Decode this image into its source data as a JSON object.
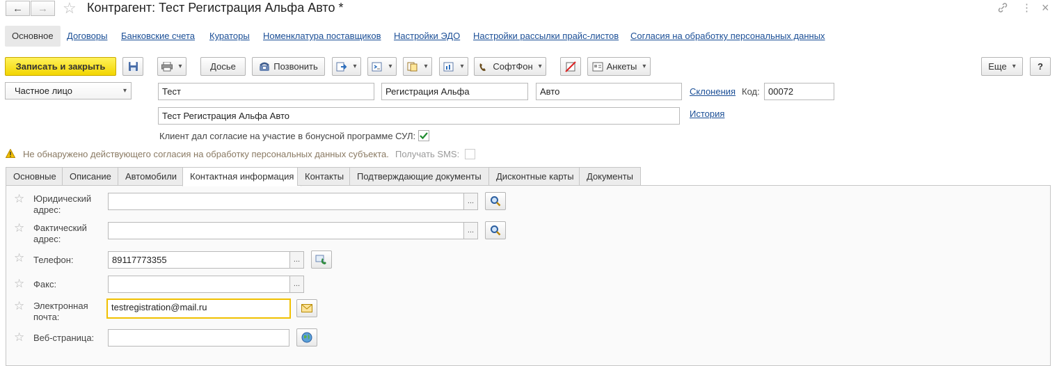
{
  "window": {
    "title": "Контрагент: Тест Регистрация Альфа Авто *",
    "back_glyph": "←",
    "forward_glyph": "→",
    "favorite_glyph": "☆",
    "link_glyph": "🔗",
    "menu_glyph": "⋮",
    "close_glyph": "×"
  },
  "sections": [
    {
      "label": "Основное"
    },
    {
      "label": "Договоры"
    },
    {
      "label": "Банковские счета"
    },
    {
      "label": "Кураторы"
    },
    {
      "label": "Номенклатура поставщиков"
    },
    {
      "label": "Настройки ЭДО"
    },
    {
      "label": "Настройки рассылки прайс-листов"
    },
    {
      "label": "Согласия на обработку персональных данных"
    }
  ],
  "toolbar": {
    "save_close": "Записать и закрыть",
    "dossier": "Досье",
    "call": "Позвонить",
    "softphone": "СофтФон",
    "surveys": "Анкеты",
    "more": "Еще",
    "help": "?"
  },
  "form": {
    "person_type": "Частное лицо",
    "last_name": "Тест",
    "first_name": "Регистрация Альфа",
    "middle_name": "Авто",
    "declensions_link": "Склонения",
    "code_label": "Код:",
    "code_value": "00072",
    "full_name": "Тест Регистрация Альфа Авто",
    "history_link": "История",
    "bonus_consent_label": "Клиент дал согласие на участие в бонусной программе СУЛ:",
    "bonus_consent_checked": true,
    "warning_text": "Не обнаружено действующего согласия на обработку персональных данных субъекта.",
    "sms_label": "Получать SMS:",
    "sms_checked": false
  },
  "tabs": [
    {
      "label": "Основные"
    },
    {
      "label": "Описание"
    },
    {
      "label": "Автомобили"
    },
    {
      "label": "Контактная информация"
    },
    {
      "label": "Контакты"
    },
    {
      "label": "Подтверждающие документы"
    },
    {
      "label": "Дисконтные карты"
    },
    {
      "label": "Документы"
    }
  ],
  "contacts": {
    "legal_address_label": "Юридический\nадрес:",
    "legal_address_value": "",
    "actual_address_label": "Фактический\nадрес:",
    "actual_address_value": "",
    "phone_label": "Телефон:",
    "phone_value": "89117773355",
    "fax_label": "Факс:",
    "fax_value": "",
    "email_label": "Электронная\nпочта:",
    "email_value": "testregistration@mail.ru",
    "web_label": "Веб-страница:",
    "web_value": "",
    "select_glyph": "...",
    "star_glyph": "☆"
  }
}
